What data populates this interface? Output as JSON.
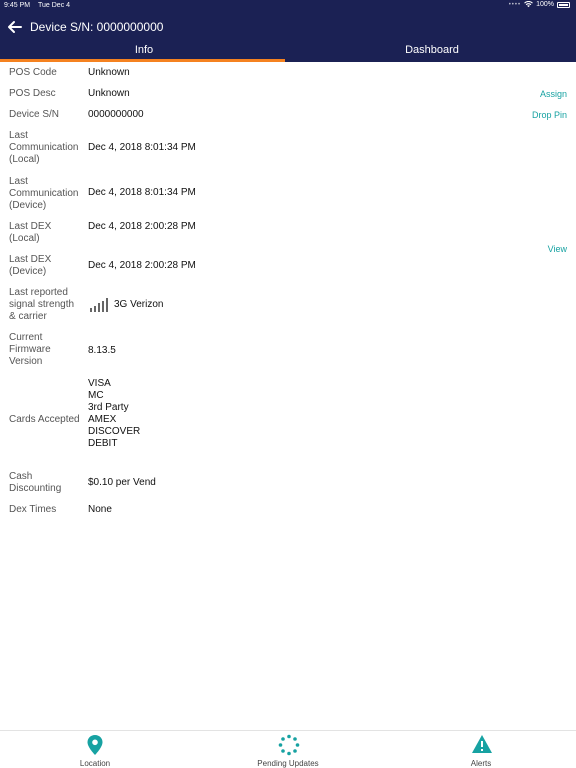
{
  "status_bar": {
    "time": "9:45 PM",
    "date": "Tue Dec 4",
    "battery": "100%"
  },
  "nav": {
    "title": "Device S/N: 0000000000"
  },
  "tabs": [
    {
      "label": "Info",
      "active": true
    },
    {
      "label": "Dashboard",
      "active": false
    }
  ],
  "details": {
    "pos_code": {
      "label": "POS Code",
      "value": "Unknown"
    },
    "pos_desc": {
      "label": "POS Desc",
      "value": "Unknown",
      "action": "Assign"
    },
    "device_sn": {
      "label": "Device S/N",
      "value": "0000000000",
      "action": "Drop Pin"
    },
    "last_comm_local": {
      "label": "Last Communication (Local)",
      "value": "Dec 4, 2018 8:01:34 PM"
    },
    "last_comm_device": {
      "label": "Last Communication (Device)",
      "value": "Dec 4, 2018 8:01:34 PM"
    },
    "last_dex_local": {
      "label": "Last DEX (Local)",
      "value": "Dec 4, 2018 2:00:28 PM"
    },
    "last_dex_device": {
      "label": "Last DEX (Device)",
      "value": "Dec 4, 2018 2:00:28 PM",
      "action": "View"
    },
    "signal": {
      "label": "Last reported signal strength & carrier",
      "value": "3G Verizon"
    },
    "firmware": {
      "label": "Current Firmware Version",
      "value": "8.13.5"
    },
    "cards": {
      "label": "Cards Accepted",
      "values": [
        "VISA",
        "MC",
        "3rd Party",
        "AMEX",
        "DISCOVER",
        "DEBIT"
      ]
    },
    "cash_discounting": {
      "label": "Cash Discounting",
      "value": "$0.10 per Vend"
    },
    "dex_times": {
      "label": "Dex Times",
      "value": "None"
    }
  },
  "bottom_tabs": [
    {
      "label": "Location",
      "icon": "location-pin-icon"
    },
    {
      "label": "Pending Updates",
      "icon": "spinner-icon"
    },
    {
      "label": "Alerts",
      "icon": "warning-icon"
    }
  ],
  "colors": {
    "nav_bg": "#1b2154",
    "tab_indicator": "#f58220",
    "accent": "#17a2a2"
  }
}
